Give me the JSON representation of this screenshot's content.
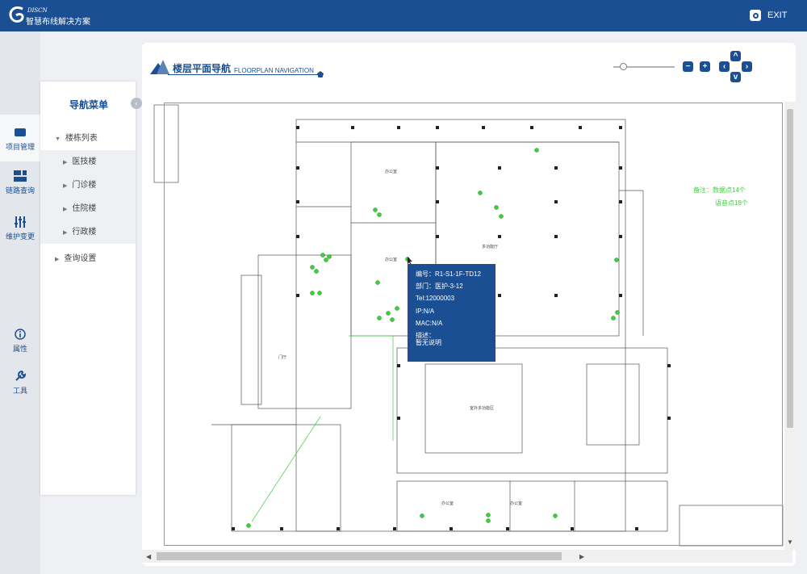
{
  "header": {
    "logo_en": "DISCN",
    "logo_cn": "智慧布线解决方案",
    "exit_label": "EXIT",
    "brand_color": "#1b4f93"
  },
  "left_rail": [
    {
      "label": "项目管理",
      "icon": "monitor-icon"
    },
    {
      "label": "链路查询",
      "icon": "layout-icon"
    },
    {
      "label": "维护变更",
      "icon": "sliders-icon"
    },
    {
      "label": "属性",
      "icon": "info-icon"
    },
    {
      "label": "工具",
      "icon": "wrench-icon"
    }
  ],
  "nav_menu": {
    "title": "导航菜单",
    "collapse_glyph": "‹",
    "group_label": "楼栋列表",
    "buildings": [
      "医技楼",
      "门诊楼",
      "住院楼",
      "行政楼"
    ],
    "query_label": "查询设置"
  },
  "panel": {
    "title_cn": "楼层平面导航",
    "title_en": "FLOORPLAN NAVIGATION",
    "zoom_level": 0.15
  },
  "tooltip": {
    "id": "编号：R1-S1-1F-TD12",
    "dept": "部门：医护-3-12",
    "tel": "Tel:12000003",
    "ip": "IP:N/A",
    "mac": "MAC:N/A",
    "desc_label": "描述：",
    "desc_value": "暂无说明"
  },
  "legend": {
    "line1": "备注：数据点14个",
    "line2": "语音点18个",
    "color": "#3ecf3e"
  },
  "plan_labels": {
    "office": "办公室",
    "hall": "门厅",
    "multi": "多功能厅",
    "outdoor": "室外多功能区"
  }
}
